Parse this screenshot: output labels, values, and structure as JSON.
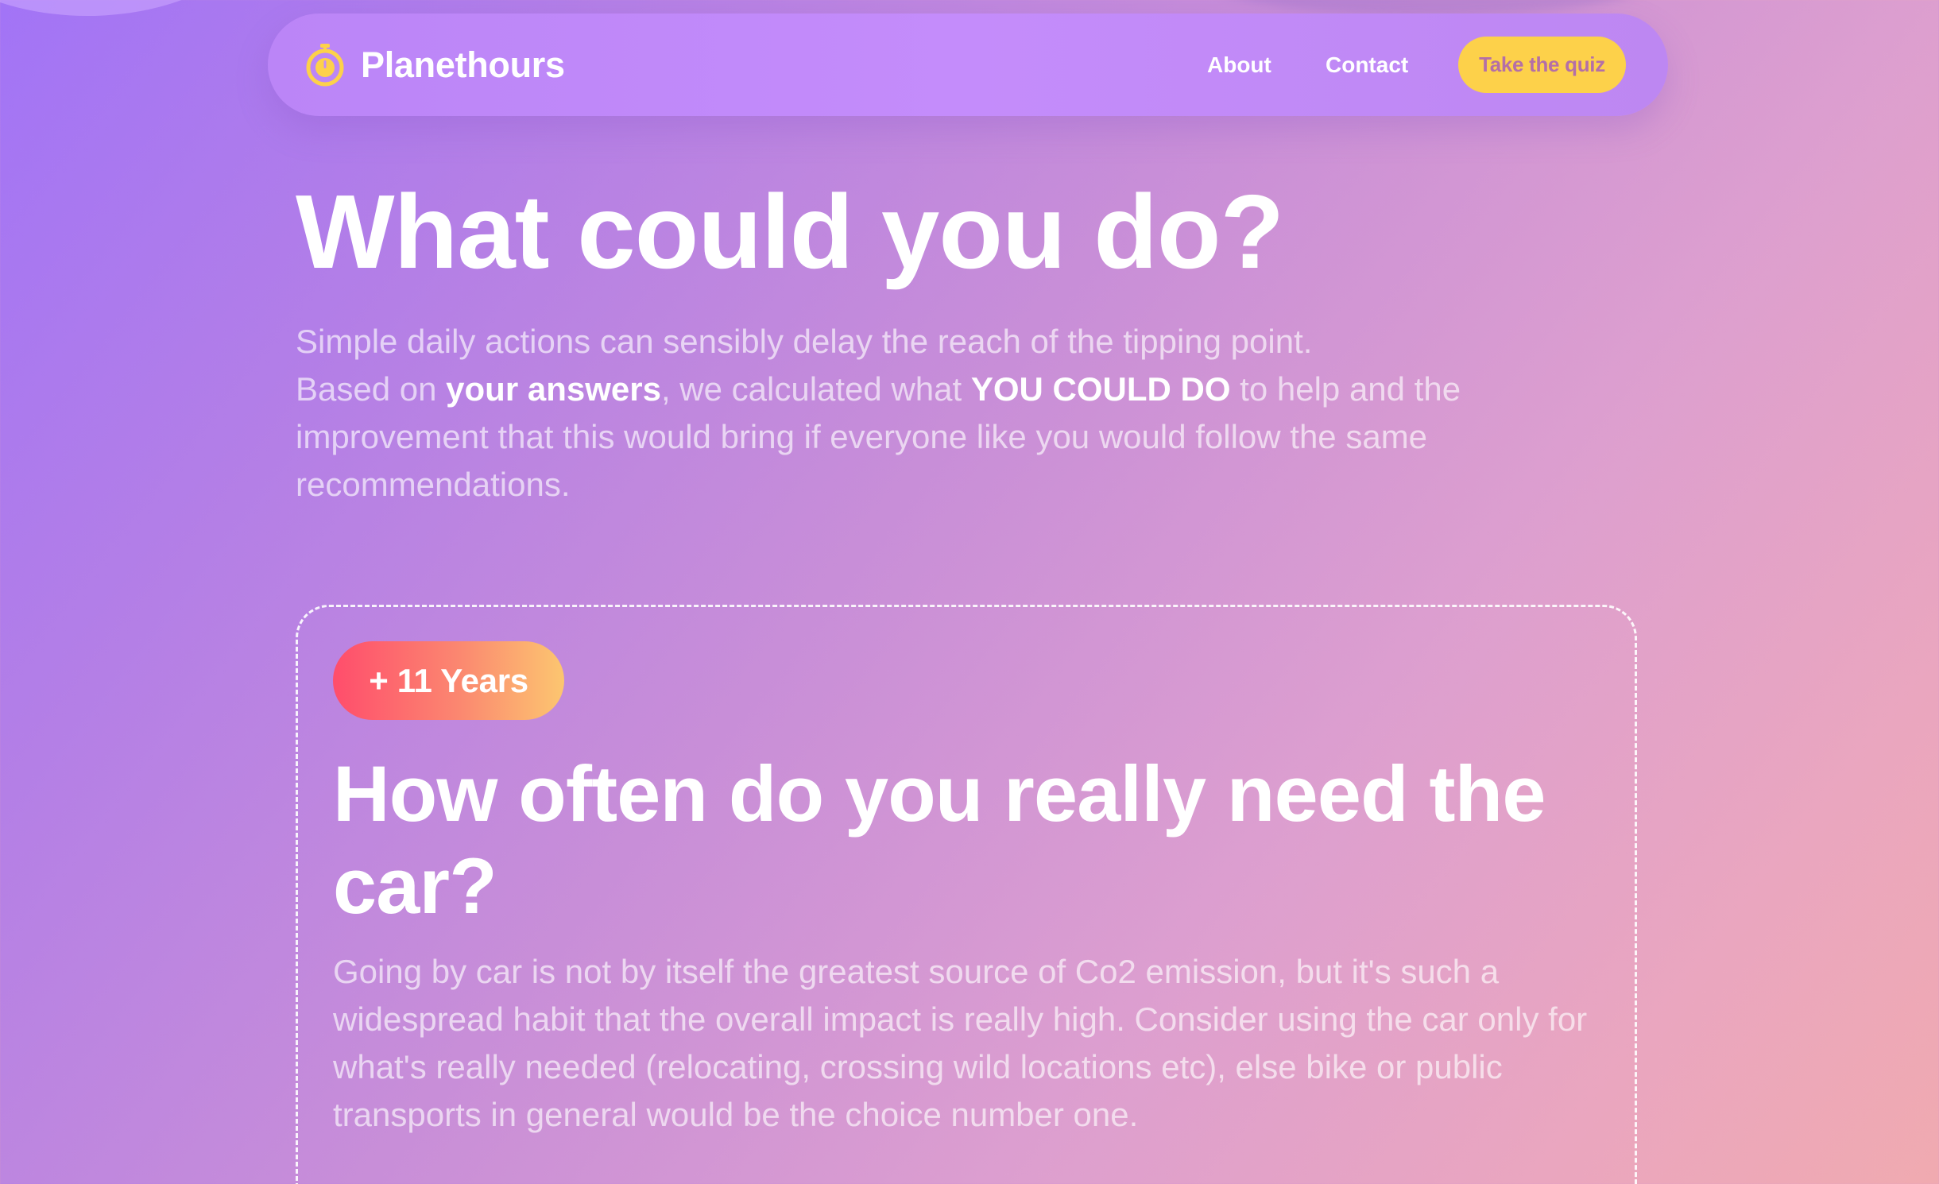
{
  "header": {
    "brand_name": "Planethours",
    "nav": {
      "about": "About",
      "contact": "Contact"
    },
    "cta_label": "Take the quiz"
  },
  "hero": {
    "title": "What could you do?",
    "line1": "Simple daily actions can sensibly delay the reach of the tipping point.",
    "line2_pre": "Based on ",
    "line2_bold1": "your answers",
    "line2_mid": ", we calculated what ",
    "line2_bold2": "YOU COULD DO",
    "line2_post": " to help and the improvement that this would bring if everyone like you would follow the same recommendations."
  },
  "suggestion": {
    "badge": "+ 11 Years",
    "title": "How often do you really need the car?",
    "description": "Going by car is not by itself the greatest source of Co2 emission, but it's such a widespread habit that the overall impact is really high. Consider using the car only for what's really needed (relocating, crossing wild locations etc), else bike or public transports in general would be the choice number one."
  },
  "colors": {
    "cta_background": "#fdd14a",
    "cta_text": "#b46fa7",
    "logo": "#fdd14a",
    "badge_gradient_start": "#ff4d6c",
    "badge_gradient_end": "#fcc670"
  },
  "icons": {
    "brand": "stopwatch-icon"
  }
}
